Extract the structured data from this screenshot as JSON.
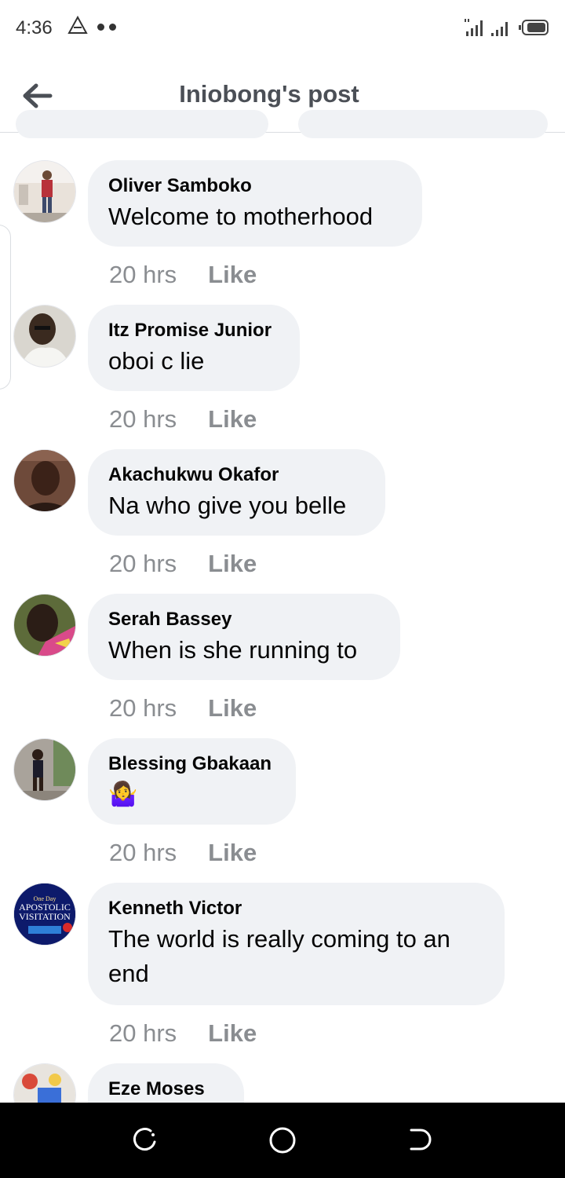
{
  "status": {
    "time": "4:36"
  },
  "header": {
    "title": "Iniobong's post"
  },
  "comments": [
    {
      "name": "Oliver Samboko",
      "text": "Welcome to motherhood",
      "time": "20 hrs",
      "like": "Like"
    },
    {
      "name": "Itz Promise Junior",
      "text": "oboi c lie",
      "time": "20 hrs",
      "like": "Like"
    },
    {
      "name": "Akachukwu Okafor",
      "text": "Na who give you belle",
      "time": "20 hrs",
      "like": "Like"
    },
    {
      "name": "Serah Bassey",
      "text": "When is she running to",
      "time": "20 hrs",
      "like": "Like"
    },
    {
      "name": "Blessing Gbakaan",
      "text": "🤷‍♀️",
      "time": "20 hrs",
      "like": "Like"
    },
    {
      "name": "Kenneth Victor",
      "text": "The world is really coming to an end",
      "time": "20 hrs",
      "like": "Like"
    },
    {
      "name": "Eze Moses",
      "text": ""
    }
  ],
  "avatar_flyer": {
    "line1": "One Day",
    "line2": "APOSTOLIC",
    "line3": "VISITATION"
  }
}
